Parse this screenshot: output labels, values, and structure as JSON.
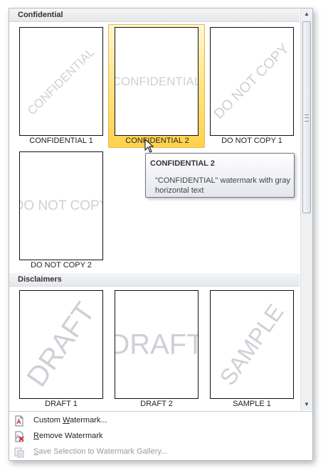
{
  "gallery": {
    "groups": [
      {
        "header": "Confidential",
        "items": [
          {
            "caption": "CONFIDENTIAL 1",
            "watermark": "CONFIDENTIAL"
          },
          {
            "caption": "CONFIDENTIAL 2",
            "watermark": "CONFIDENTIAL"
          },
          {
            "caption": "DO NOT COPY 1",
            "watermark": "DO NOT COPY"
          },
          {
            "caption": "DO NOT COPY 2",
            "watermark": "DO NOT COPY"
          }
        ]
      },
      {
        "header": "Disclaimers",
        "items": [
          {
            "caption": "DRAFT 1",
            "watermark": "DRAFT"
          },
          {
            "caption": "DRAFT 2",
            "watermark": "DRAFT"
          },
          {
            "caption": "SAMPLE 1",
            "watermark": "SAMPLE"
          }
        ]
      }
    ],
    "hovered_item": "CONFIDENTIAL 2"
  },
  "tooltip": {
    "title": "CONFIDENTIAL 2",
    "body": "\"CONFIDENTIAL\" watermark with gray horizontal text"
  },
  "menu": {
    "custom": {
      "prefix": "Custom ",
      "mnemonic": "W",
      "suffix": "atermark...",
      "enabled": true
    },
    "remove": {
      "prefix": "",
      "mnemonic": "R",
      "suffix": "emove Watermark",
      "enabled": true
    },
    "save": {
      "prefix": "",
      "mnemonic": "S",
      "suffix": "ave Selection to Watermark Gallery...",
      "enabled": false
    }
  },
  "colors": {
    "hover_fill": "#ffd24d",
    "watermark_gray": "#cdd1d5",
    "disabled_text": "#9a9a9a"
  },
  "icons": [
    "watermark-doc-icon",
    "remove-watermark-icon",
    "save-to-gallery-icon",
    "scroll-up-icon",
    "scroll-down-icon",
    "mouse-pointer-icon"
  ]
}
